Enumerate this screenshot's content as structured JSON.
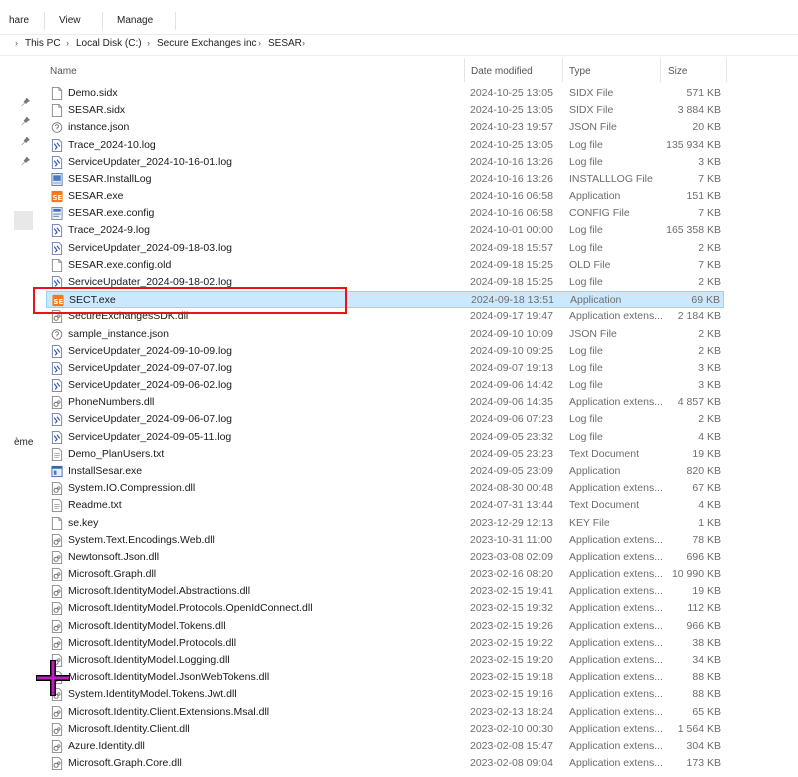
{
  "ribbon": {
    "share": "hare",
    "view": "View",
    "manage": "Manage"
  },
  "address": [
    "This PC",
    "Local Disk (C:)",
    "Secure Exchanges inc",
    "SESAR"
  ],
  "left_fragment": "ème",
  "columns": {
    "name": "Name",
    "date": "Date modified",
    "type": "Type",
    "size": "Size"
  },
  "files": [
    {
      "name": "Demo.sidx",
      "date": "2024-10-25 13:05",
      "type": "SIDX File",
      "size": "571 KB",
      "icon": "generic-file-icon"
    },
    {
      "name": "SESAR.sidx",
      "date": "2024-10-25 13:05",
      "type": "SIDX File",
      "size": "3 884 KB",
      "icon": "generic-file-icon"
    },
    {
      "name": "instance.json",
      "date": "2024-10-23 19:57",
      "type": "JSON File",
      "size": "20 KB",
      "icon": "json-file-icon"
    },
    {
      "name": "Trace_2024-10.log",
      "date": "2024-10-25 13:05",
      "type": "Log file",
      "size": "135 934 KB",
      "icon": "log-file-icon"
    },
    {
      "name": "ServiceUpdater_2024-10-16-01.log",
      "date": "2024-10-16 13:26",
      "type": "Log file",
      "size": "3 KB",
      "icon": "log-file-icon"
    },
    {
      "name": "SESAR.InstallLog",
      "date": "2024-10-16 13:26",
      "type": "INSTALLLOG File",
      "size": "7 KB",
      "icon": "installlog-file-icon"
    },
    {
      "name": "SESAR.exe",
      "date": "2024-10-16 06:58",
      "type": "Application",
      "size": "151 KB",
      "icon": "se-app-icon"
    },
    {
      "name": "SESAR.exe.config",
      "date": "2024-10-16 06:58",
      "type": "CONFIG File",
      "size": "7 KB",
      "icon": "config-file-icon"
    },
    {
      "name": "Trace_2024-9.log",
      "date": "2024-10-01 00:00",
      "type": "Log file",
      "size": "165 358 KB",
      "icon": "log-file-icon"
    },
    {
      "name": "ServiceUpdater_2024-09-18-03.log",
      "date": "2024-09-18 15:57",
      "type": "Log file",
      "size": "2 KB",
      "icon": "log-file-icon"
    },
    {
      "name": "SESAR.exe.config.old",
      "date": "2024-09-18 15:25",
      "type": "OLD File",
      "size": "7 KB",
      "icon": "generic-file-icon"
    },
    {
      "name": "ServiceUpdater_2024-09-18-02.log",
      "date": "2024-09-18 15:25",
      "type": "Log file",
      "size": "2 KB",
      "icon": "log-file-icon"
    },
    {
      "name": "SECT.exe",
      "date": "2024-09-18 13:51",
      "type": "Application",
      "size": "69 KB",
      "icon": "se-app-icon",
      "selected": true
    },
    {
      "name": "SecureExchangesSDK.dll",
      "date": "2024-09-17 19:47",
      "type": "Application extens...",
      "size": "2 184 KB",
      "icon": "dll-file-icon"
    },
    {
      "name": "sample_instance.json",
      "date": "2024-09-10 10:09",
      "type": "JSON File",
      "size": "2 KB",
      "icon": "json-file-icon"
    },
    {
      "name": "ServiceUpdater_2024-09-10-09.log",
      "date": "2024-09-10 09:25",
      "type": "Log file",
      "size": "2 KB",
      "icon": "log-file-icon"
    },
    {
      "name": "ServiceUpdater_2024-09-07-07.log",
      "date": "2024-09-07 19:13",
      "type": "Log file",
      "size": "3 KB",
      "icon": "log-file-icon"
    },
    {
      "name": "ServiceUpdater_2024-09-06-02.log",
      "date": "2024-09-06 14:42",
      "type": "Log file",
      "size": "3 KB",
      "icon": "log-file-icon"
    },
    {
      "name": "PhoneNumbers.dll",
      "date": "2024-09-06 14:35",
      "type": "Application extens...",
      "size": "4 857 KB",
      "icon": "dll-file-icon"
    },
    {
      "name": "ServiceUpdater_2024-09-06-07.log",
      "date": "2024-09-06 07:23",
      "type": "Log file",
      "size": "2 KB",
      "icon": "log-file-icon"
    },
    {
      "name": "ServiceUpdater_2024-09-05-11.log",
      "date": "2024-09-05 23:32",
      "type": "Log file",
      "size": "4 KB",
      "icon": "log-file-icon"
    },
    {
      "name": "Demo_PlanUsers.txt",
      "date": "2024-09-05 23:23",
      "type": "Text Document",
      "size": "19 KB",
      "icon": "text-file-icon"
    },
    {
      "name": "InstallSesar.exe",
      "date": "2024-09-05 23:09",
      "type": "Application",
      "size": "820 KB",
      "icon": "installer-app-icon"
    },
    {
      "name": "System.IO.Compression.dll",
      "date": "2024-08-30 00:48",
      "type": "Application extens...",
      "size": "67 KB",
      "icon": "dll-file-icon"
    },
    {
      "name": "Readme.txt",
      "date": "2024-07-31 13:44",
      "type": "Text Document",
      "size": "4 KB",
      "icon": "text-file-icon"
    },
    {
      "name": "se.key",
      "date": "2023-12-29 12:13",
      "type": "KEY File",
      "size": "1 KB",
      "icon": "generic-file-icon"
    },
    {
      "name": "System.Text.Encodings.Web.dll",
      "date": "2023-10-31 11:00",
      "type": "Application extens...",
      "size": "78 KB",
      "icon": "dll-file-icon"
    },
    {
      "name": "Newtonsoft.Json.dll",
      "date": "2023-03-08 02:09",
      "type": "Application extens...",
      "size": "696 KB",
      "icon": "dll-file-icon"
    },
    {
      "name": "Microsoft.Graph.dll",
      "date": "2023-02-16 08:20",
      "type": "Application extens...",
      "size": "10 990 KB",
      "icon": "dll-file-icon"
    },
    {
      "name": "Microsoft.IdentityModel.Abstractions.dll",
      "date": "2023-02-15 19:41",
      "type": "Application extens...",
      "size": "19 KB",
      "icon": "dll-file-icon"
    },
    {
      "name": "Microsoft.IdentityModel.Protocols.OpenIdConnect.dll",
      "date": "2023-02-15 19:32",
      "type": "Application extens...",
      "size": "112 KB",
      "icon": "dll-file-icon"
    },
    {
      "name": "Microsoft.IdentityModel.Tokens.dll",
      "date": "2023-02-15 19:26",
      "type": "Application extens...",
      "size": "966 KB",
      "icon": "dll-file-icon"
    },
    {
      "name": "Microsoft.IdentityModel.Protocols.dll",
      "date": "2023-02-15 19:22",
      "type": "Application extens...",
      "size": "38 KB",
      "icon": "dll-file-icon"
    },
    {
      "name": "Microsoft.IdentityModel.Logging.dll",
      "date": "2023-02-15 19:20",
      "type": "Application extens...",
      "size": "34 KB",
      "icon": "dll-file-icon"
    },
    {
      "name": "Microsoft.IdentityModel.JsonWebTokens.dll",
      "date": "2023-02-15 19:18",
      "type": "Application extens...",
      "size": "88 KB",
      "icon": "dll-file-icon"
    },
    {
      "name": "System.IdentityModel.Tokens.Jwt.dll",
      "date": "2023-02-15 19:16",
      "type": "Application extens...",
      "size": "88 KB",
      "icon": "dll-file-icon"
    },
    {
      "name": "Microsoft.Identity.Client.Extensions.Msal.dll",
      "date": "2023-02-13 18:24",
      "type": "Application extens...",
      "size": "65 KB",
      "icon": "dll-file-icon"
    },
    {
      "name": "Microsoft.Identity.Client.dll",
      "date": "2023-02-10 00:30",
      "type": "Application extens...",
      "size": "1 564 KB",
      "icon": "dll-file-icon"
    },
    {
      "name": "Azure.Identity.dll",
      "date": "2023-02-08 15:47",
      "type": "Application extens...",
      "size": "304 KB",
      "icon": "dll-file-icon"
    },
    {
      "name": "Microsoft.Graph.Core.dll",
      "date": "2023-02-08 09:04",
      "type": "Application extens...",
      "size": "173 KB",
      "icon": "dll-file-icon"
    }
  ]
}
